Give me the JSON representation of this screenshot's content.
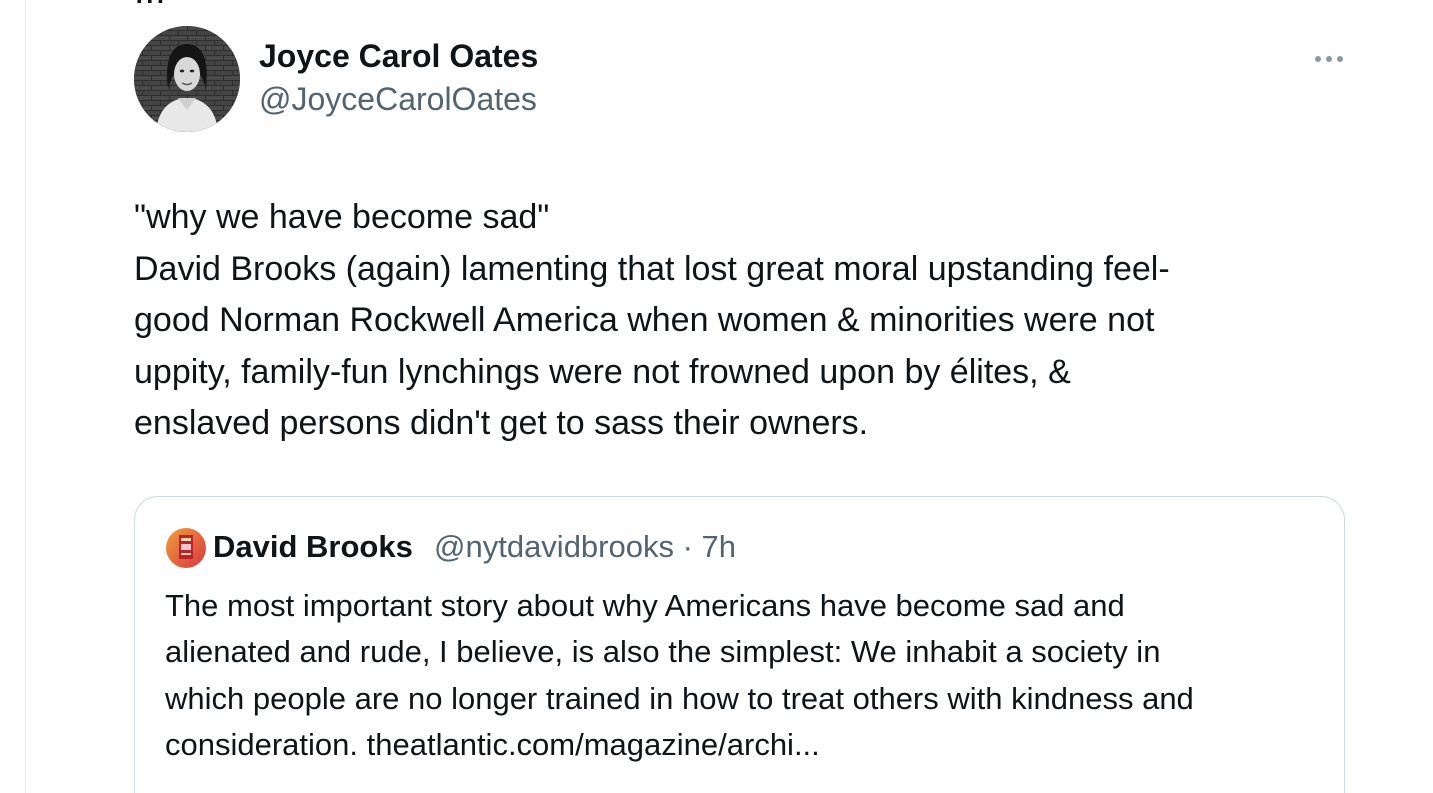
{
  "tweet": {
    "top_cut_text": "...",
    "author": {
      "name": "Joyce Carol Oates",
      "handle": "@JoyceCarolOates"
    },
    "more_icon": "more-horizontal-icon",
    "text_lines": [
      "\"why we have become sad\"",
      "David Brooks (again) lamenting that lost great moral upstanding feel-",
      "good Norman Rockwell America when women & minorities were not",
      "uppity, family-fun lynchings were not frowned upon by élites, &",
      "enslaved persons didn't get to sass their owners."
    ]
  },
  "quoted_tweet": {
    "author_name": "David Brooks",
    "handle_time": "@nytdavidbrooks · 7h",
    "text_lines": [
      "The most important story about why Americans have become sad and",
      "alienated and rude, I believe, is also the simplest: We inhabit a society in",
      "which people are no longer trained in how to treat others with kindness and",
      "consideration.  theatlantic.com/magazine/archi..."
    ]
  },
  "colors": {
    "text_primary": "#0f1419",
    "text_secondary": "#536471",
    "border": "#cfd9de"
  }
}
